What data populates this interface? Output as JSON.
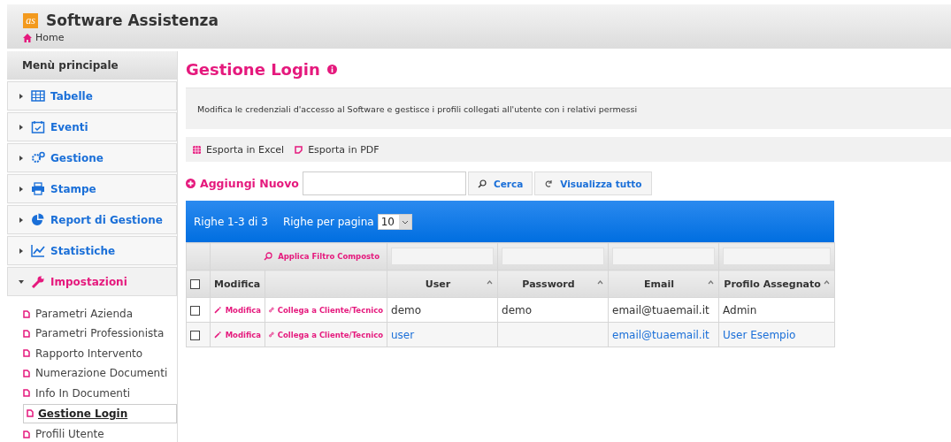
{
  "header": {
    "logo": "as",
    "title": "Software Assistenza",
    "breadcrumb": "Home"
  },
  "sidebar": {
    "title": "Menù principale",
    "sections": [
      {
        "label": "Tabelle",
        "expanded": false
      },
      {
        "label": "Eventi",
        "expanded": false
      },
      {
        "label": "Gestione",
        "expanded": false
      },
      {
        "label": "Stampe",
        "expanded": false
      },
      {
        "label": "Report di Gestione",
        "expanded": false
      },
      {
        "label": "Statistiche",
        "expanded": false
      },
      {
        "label": "Impostazioni",
        "expanded": true,
        "items": [
          {
            "label": "Parametri Azienda",
            "selected": false
          },
          {
            "label": "Parametri Professionista",
            "selected": false
          },
          {
            "label": "Rapporto Intervento",
            "selected": false
          },
          {
            "label": "Numerazione Documenti",
            "selected": false
          },
          {
            "label": "Info In Documenti",
            "selected": false
          },
          {
            "label": "Gestione Login",
            "selected": true
          },
          {
            "label": "Profili Utente",
            "selected": false
          }
        ]
      }
    ]
  },
  "page": {
    "title": "Gestione Login",
    "description": "Modifica le credenziali d'accesso al Software e gestisce i profili collegati all'utente con i relativi permessi"
  },
  "exports": [
    {
      "label": "Esporta in Excel",
      "kind": "excel"
    },
    {
      "label": "Esporta in PDF",
      "kind": "pdf"
    }
  ],
  "toolbar": {
    "add": "Aggiungi Nuovo",
    "search": "Cerca",
    "show_all": "Visualizza tutto"
  },
  "table": {
    "summary": "Righe 1-3 di 3",
    "per_page_label": "Righe per pagina",
    "per_page": "10",
    "filter_button": "Applica Filtro Composto",
    "select_all_checked": false,
    "columns": [
      "Modifica",
      "User",
      "Password",
      "Email",
      "Profilo Assegnato"
    ],
    "rows": [
      {
        "checked": false,
        "edit": "Modifica",
        "link": "Collega a Cliente/Tecnico",
        "user": "demo",
        "password": "demo",
        "email": "email@tuaemail.it",
        "profile": "Admin",
        "highlighted": false
      },
      {
        "checked": false,
        "edit": "Modifica",
        "link": "Collega a Cliente/Tecnico",
        "user": "user",
        "password": "",
        "email": "email@tuaemail.it",
        "profile": "User Esempio",
        "highlighted": true
      }
    ]
  }
}
